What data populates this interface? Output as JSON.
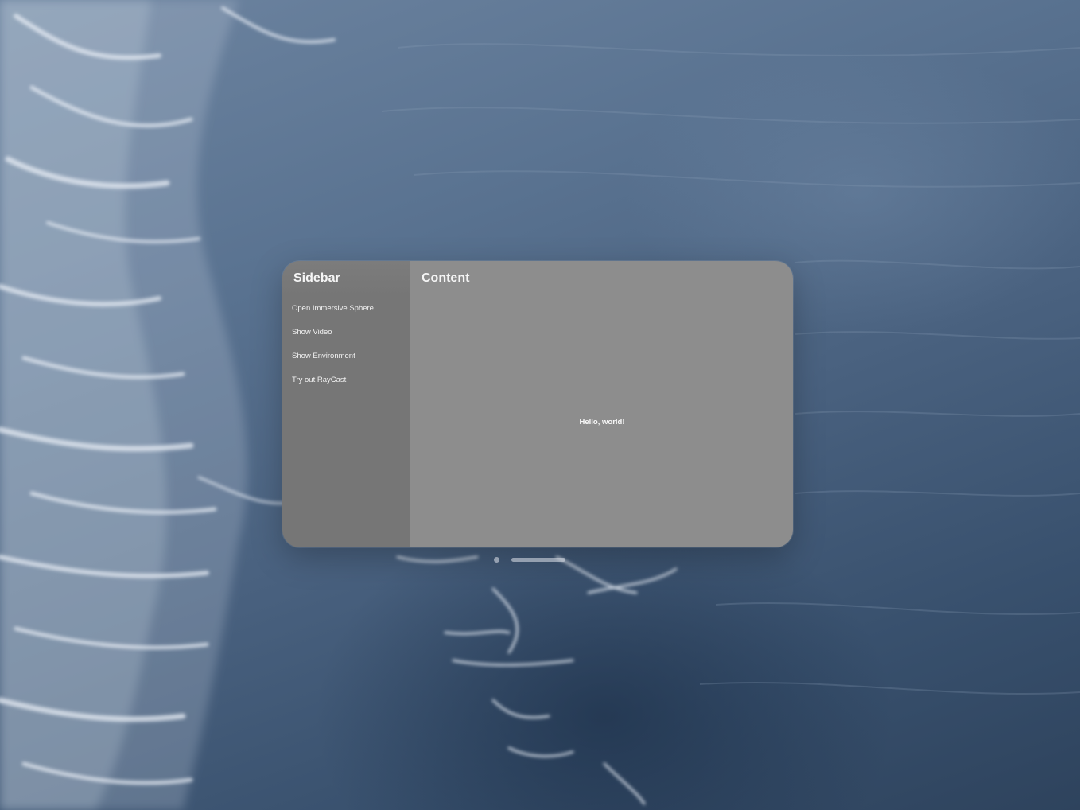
{
  "window": {
    "sidebar": {
      "title": "Sidebar",
      "items": [
        {
          "label": "Open Immersive Sphere",
          "name": "sidebar-item-open-immersive-sphere"
        },
        {
          "label": "Show Video",
          "name": "sidebar-item-show-video"
        },
        {
          "label": "Show Environment",
          "name": "sidebar-item-show-environment"
        },
        {
          "label": "Try out RayCast",
          "name": "sidebar-item-try-out-raycast"
        }
      ]
    },
    "content": {
      "title": "Content",
      "message": "Hello, world!"
    }
  },
  "controls": {
    "close_icon": "close-dot-icon",
    "grabber_icon": "window-grabber-bar-icon"
  },
  "colors": {
    "sidebar_bg": "#767676",
    "content_bg": "#8d8d8d",
    "text": "#f5f5f5",
    "background_water": "#4a6280"
  }
}
